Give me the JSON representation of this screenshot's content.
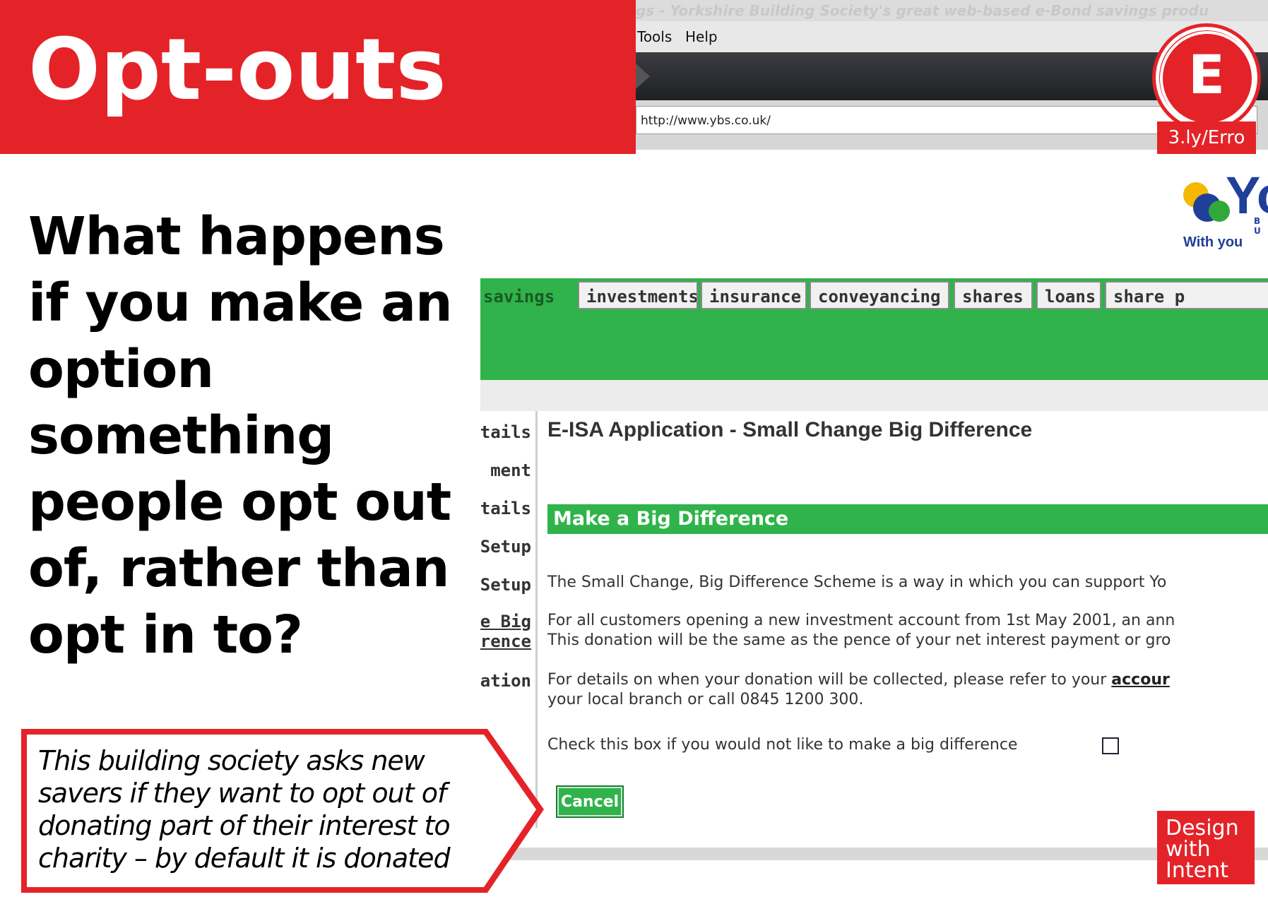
{
  "slide": {
    "title": "Opt-outs",
    "question": "What happens if you make an option something people opt out of, rather than opt in to?",
    "callout": "This building society asks new savers if they want to opt out of donating part of their interest to charity – by default it is donated",
    "badge_letter": "E",
    "badge_link": "3.ly/Erro",
    "brand_lines": [
      "Design",
      "with",
      "Intent"
    ],
    "colors": {
      "accent": "#e42329",
      "site_green": "#2fb34a",
      "logo_blue": "#1f3f99"
    }
  },
  "browser": {
    "window_title": "gs - Yorkshire Building Society's great web-based e-Bond savings produ",
    "menus": [
      "Tools",
      "Help"
    ],
    "url": "http://www.ybs.co.uk/"
  },
  "site": {
    "logo_letters": "Yo",
    "logo_sub": "B U",
    "logo_tagline": "With you",
    "tabs": [
      {
        "label": "savings",
        "active": true
      },
      {
        "label": "investments",
        "active": false
      },
      {
        "label": "insurance",
        "active": false
      },
      {
        "label": "conveyancing",
        "active": false
      },
      {
        "label": "shares",
        "active": false
      },
      {
        "label": "loans",
        "active": false
      },
      {
        "label": "share p",
        "active": false
      }
    ],
    "leftnav": [
      "etails",
      "ment",
      "etails",
      "Setup",
      "Setup",
      "e Big",
      "rence",
      "ation"
    ],
    "heading": "E-ISA Application - Small Change Big Difference",
    "section_title": "Make a Big Difference",
    "para1": "The Small Change, Big Difference Scheme is a way in which you can support Yo",
    "para2_line1": "For all customers opening a new investment account from 1st May 2001, an ann",
    "para2_line2": "This donation will be the same as the pence of your net interest payment or gro",
    "para3_line1": "For details on when your donation will be collected, please refer to your",
    "para3_link": "accour",
    "para3_line2": "your local branch or call 0845 1200 300.",
    "optout_label": "Check this box if you would not like to make a big difference",
    "optout_checked": false,
    "cancel_label": "Cancel"
  }
}
